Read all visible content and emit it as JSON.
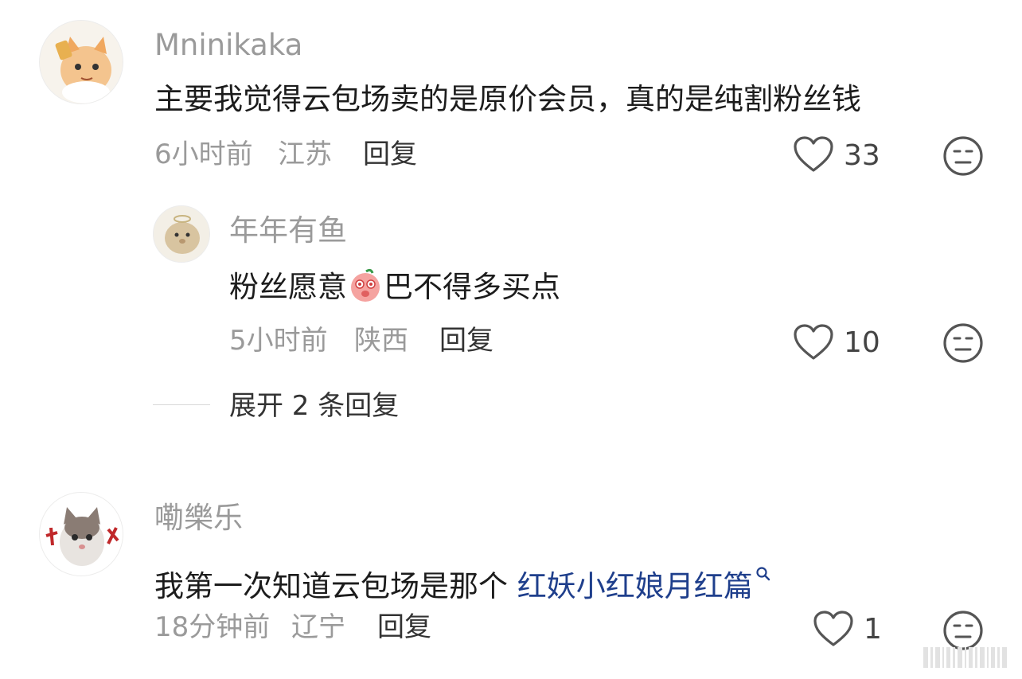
{
  "comments": [
    {
      "username": "Mninikaka",
      "text": "主要我觉得云包场卖的是原价会员，真的是纯割粉丝钱",
      "time": "6小时前",
      "location": "江苏",
      "reply_label": "回复",
      "likes": "33",
      "reply": {
        "username": "年年有鱼",
        "text_before_emoji": "粉丝愿意",
        "emoji": "peach-face-emoji",
        "text_after_emoji": "巴不得多买点",
        "time": "5小时前",
        "location": "陕西",
        "reply_label": "回复",
        "likes": "10"
      },
      "expand_label": "展开 2 条回复"
    },
    {
      "username": "嘞樂乐",
      "text": "我第一次知道云包场是那个 ",
      "link_text": "红妖小红娘月红篇",
      "time": "18分钟前",
      "location": "辽宁",
      "reply_label": "回复",
      "likes": "1"
    }
  ],
  "icons": {
    "like": "heart-outline-icon",
    "dislike": "neutral-face-icon",
    "search": "search-icon"
  },
  "colors": {
    "link": "#1f3f8c",
    "muted": "#9a9a9a",
    "text": "#1c1c1c"
  }
}
